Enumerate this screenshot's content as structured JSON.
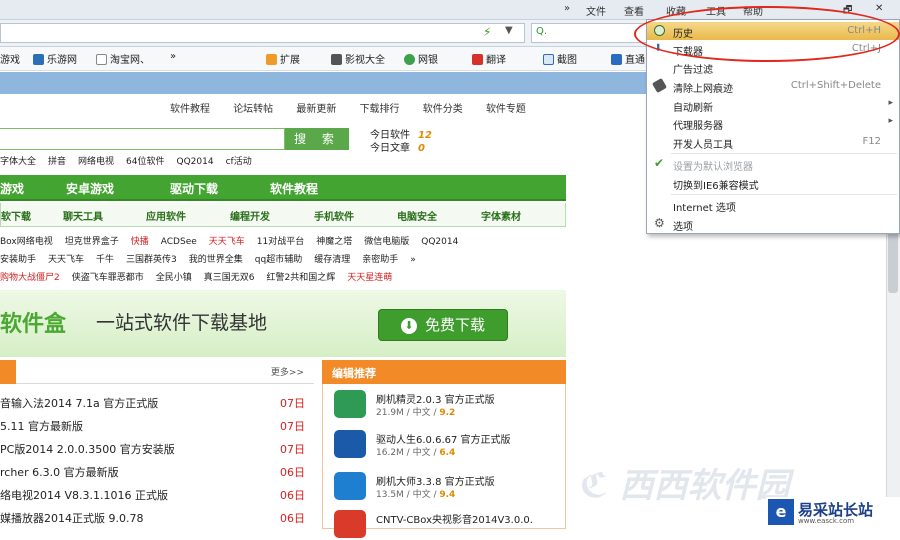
{
  "menubar": {
    "chevron": "»",
    "items": [
      "文件",
      "查看",
      "收藏",
      "工具",
      "帮助"
    ]
  },
  "window_controls": {
    "restore": "🗗",
    "close": "✕"
  },
  "bookmarks": [
    "游戏",
    "乐游网",
    "淘宝网、",
    "»",
    "扩展",
    "影视大全",
    "网银",
    "翻译",
    "截图",
    "直通"
  ],
  "top_nav": [
    "软件教程",
    "论坛转帖",
    "最新更新",
    "下载排行",
    "软件分类",
    "软件专题"
  ],
  "search": {
    "button": "搜 索",
    "today_soft_label": "今日软件",
    "today_soft_count": "12",
    "today_article_label": "今日文章",
    "today_article_count": "0"
  },
  "hot_words": [
    "字体大全",
    "拼音",
    "网络电视",
    "64位软件",
    "QQ2014",
    "cf活动"
  ],
  "green_nav": [
    "游戏",
    "安卓游戏",
    "驱动下载",
    "软件教程"
  ],
  "sub_nav": [
    "软下载",
    "聊天工具",
    "应用软件",
    "编程开发",
    "手机软件",
    "电脑安全",
    "字体素材"
  ],
  "link_rows": [
    [
      "Box网络电视",
      "坦克世界盒子",
      "快播",
      "ACDSee",
      "天天飞车",
      "11对战平台",
      "神魔之塔",
      "微信电脑版",
      "QQ2014"
    ],
    [
      "安装助手",
      "天天飞车",
      "千牛",
      "三国群英传3",
      "我的世界全集",
      "qq超市辅助",
      "缓存清理",
      "亲密助手",
      "»"
    ],
    [
      "购物大战僵尸2",
      "侠盗飞车罪恶都市",
      "全民小镇",
      "真三国无双6",
      "红警2共和国之辉",
      "天天星连萌"
    ]
  ],
  "banner": {
    "title": "软件盒",
    "slogan": "一站式软件下载基地",
    "button": "免费下载"
  },
  "left_list": {
    "more": "更多>>",
    "rows": [
      {
        "name": "音输入法2014 7.1a 官方正式版",
        "date": "07日"
      },
      {
        "name": "5.11 官方最新版",
        "date": "07日"
      },
      {
        "name": "PC版2014 2.0.0.3500 官方安装版",
        "date": "07日"
      },
      {
        "name": "rcher 6.3.0 官方最新版",
        "date": "06日"
      },
      {
        "name": "络电视2014 V8.3.1.1016 正式版",
        "date": "06日"
      },
      {
        "name": "媒播放器2014正式版 9.0.78",
        "date": "06日"
      }
    ]
  },
  "editor_picks": {
    "title": "编辑推荐",
    "items": [
      {
        "name": "刷机精灵2.0.3 官方正式版",
        "size": "21.9M",
        "lang": "中文",
        "score": "9.2",
        "color": "#2f9a53"
      },
      {
        "name": "驱动人生6.0.6.67 官方正式版",
        "size": "16.2M",
        "lang": "中文",
        "score": "6.4",
        "color": "#1b5aa8"
      },
      {
        "name": "刷机大师3.3.8 官方正式版",
        "size": "13.5M",
        "lang": "中文",
        "score": "9.4",
        "color": "#1e7fd0"
      },
      {
        "name": "CNTV-CBox央视影音2014V3.0.0.",
        "size": "",
        "lang": "",
        "score": "",
        "color": "#d93a2a"
      }
    ]
  },
  "context_menu": {
    "items": [
      {
        "label": "历史",
        "shortcut": "Ctrl+H",
        "icon": "clock-icon"
      },
      {
        "label": "下载器",
        "shortcut": "Ctrl+J",
        "icon": "download-icon"
      },
      {
        "label": "广告过滤",
        "shortcut": "",
        "icon": ""
      },
      {
        "label": "清除上网痕迹",
        "shortcut": "Ctrl+Shift+Delete",
        "icon": "eraser-icon"
      },
      {
        "label": "自动刷新",
        "shortcut": "",
        "icon": "",
        "submenu": "▸"
      },
      {
        "label": "代理服务器",
        "shortcut": "",
        "icon": "",
        "submenu": "▸"
      },
      {
        "label": "开发人员工具",
        "shortcut": "F12",
        "icon": ""
      },
      {
        "label": "设置为默认浏览器",
        "shortcut": "",
        "icon": "check-icon",
        "disabled": true
      },
      {
        "label": "切换到IE6兼容模式",
        "shortcut": "",
        "icon": ""
      },
      {
        "label": "Internet 选项",
        "shortcut": "",
        "icon": ""
      },
      {
        "label": "选项",
        "shortcut": "",
        "icon": "gear-icon"
      }
    ]
  },
  "site_logo": {
    "glyph": "e",
    "name": "易采站长站",
    "url": "www.easck.com"
  }
}
